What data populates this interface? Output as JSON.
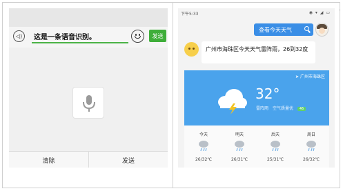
{
  "left_screen": {
    "input_text": "这是一条语音识别。",
    "send_label": "发送",
    "bottom_clear": "清除",
    "bottom_send": "发送"
  },
  "right_screen": {
    "status_time": "下午5:33",
    "status_icons": "◉ ▾ ◢ ▭",
    "query_text": "查看今天天气",
    "answer_text": "广州市海珠区今天天气雷阵雨，26到32度",
    "location": "广州市海珠区",
    "temperature": "32°",
    "weather_desc": "雷阵雨",
    "air_quality_label": "空气质量优",
    "air_quality_badge": "46",
    "forecast": [
      {
        "day": "今天",
        "range": "26/32℃"
      },
      {
        "day": "明天",
        "range": "26/31℃"
      },
      {
        "day": "后天",
        "range": "25/31℃"
      },
      {
        "day": "周日",
        "range": "26/32℃"
      }
    ]
  },
  "colors": {
    "accent_green": "#3fae3a",
    "query_blue": "#3a8ee6",
    "card_blue": "#4aa3ec"
  }
}
